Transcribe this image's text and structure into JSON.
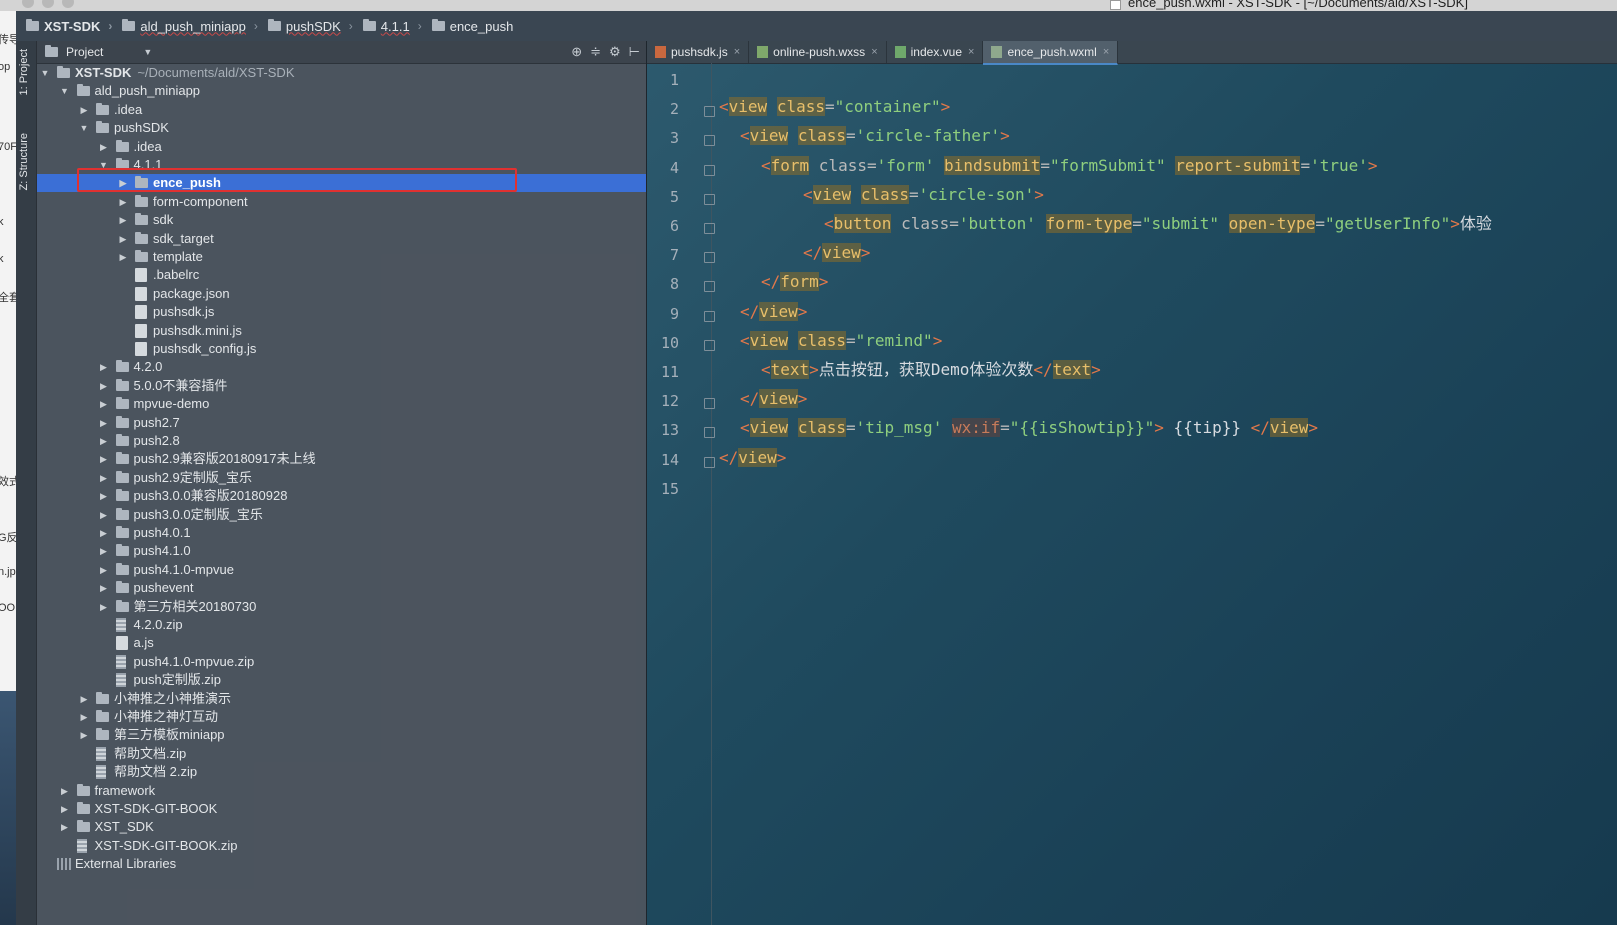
{
  "window": {
    "title": "ence_push.wxml - XST-SDK - [~/Documents/ald/XST-SDK]"
  },
  "breadcrumb": [
    {
      "label": "XST-SDK",
      "bold": true
    },
    {
      "label": "ald_push_miniapp"
    },
    {
      "label": "pushSDK"
    },
    {
      "label": "4.1.1"
    },
    {
      "label": "ence_push"
    }
  ],
  "left_strip_fragments": [
    "传导",
    "op",
    "70F",
    "k",
    "k",
    "全套",
    "效式",
    "G反",
    "n.jp",
    "OO"
  ],
  "tool_stripe": {
    "project_tab": "1: Project",
    "structure_tab": "Z: Structure"
  },
  "project_panel": {
    "title": "Project",
    "items": [
      {
        "label": "XST-SDK",
        "suffix": "~/Documents/ald/XST-SDK",
        "type": "folder",
        "state": "open"
      },
      {
        "label": "ald_push_miniapp",
        "type": "folder",
        "state": "open"
      },
      {
        "label": ".idea",
        "type": "folder",
        "state": "closed"
      },
      {
        "label": "pushSDK",
        "type": "folder",
        "state": "open"
      },
      {
        "label": ".idea",
        "type": "folder",
        "state": "closed"
      },
      {
        "label": "4.1.1",
        "type": "folder",
        "state": "open"
      },
      {
        "label": "ence_push",
        "type": "folder",
        "state": "closed",
        "selected": true
      },
      {
        "label": "form-component",
        "type": "folder",
        "state": "closed"
      },
      {
        "label": "sdk",
        "type": "folder",
        "state": "closed"
      },
      {
        "label": "sdk_target",
        "type": "folder",
        "state": "closed"
      },
      {
        "label": "template",
        "type": "folder",
        "state": "closed"
      },
      {
        "label": ".babelrc",
        "type": "file"
      },
      {
        "label": "package.json",
        "type": "file"
      },
      {
        "label": "pushsdk.js",
        "type": "file"
      },
      {
        "label": "pushsdk.mini.js",
        "type": "file"
      },
      {
        "label": "pushsdk_config.js",
        "type": "file"
      },
      {
        "label": "4.2.0",
        "type": "folder",
        "state": "closed"
      },
      {
        "label": "5.0.0不兼容插件",
        "type": "folder",
        "state": "closed"
      },
      {
        "label": "mpvue-demo",
        "type": "folder",
        "state": "closed"
      },
      {
        "label": "push2.7",
        "type": "folder",
        "state": "closed"
      },
      {
        "label": "push2.8",
        "type": "folder",
        "state": "closed"
      },
      {
        "label": "push2.9兼容版20180917未上线",
        "type": "folder",
        "state": "closed"
      },
      {
        "label": "push2.9定制版_宝乐",
        "type": "folder",
        "state": "closed"
      },
      {
        "label": "push3.0.0兼容版20180928",
        "type": "folder",
        "state": "closed"
      },
      {
        "label": "push3.0.0定制版_宝乐",
        "type": "folder",
        "state": "closed"
      },
      {
        "label": "push4.0.1",
        "type": "folder",
        "state": "closed"
      },
      {
        "label": "push4.1.0",
        "type": "folder",
        "state": "closed"
      },
      {
        "label": "push4.1.0-mpvue",
        "type": "folder",
        "state": "closed"
      },
      {
        "label": "pushevent",
        "type": "folder",
        "state": "closed"
      },
      {
        "label": "第三方相关20180730",
        "type": "folder",
        "state": "closed"
      },
      {
        "label": "4.2.0.zip",
        "type": "zip"
      },
      {
        "label": "a.js",
        "type": "file"
      },
      {
        "label": "push4.1.0-mpvue.zip",
        "type": "zip"
      },
      {
        "label": "push定制版.zip",
        "type": "zip"
      },
      {
        "label": "小神推之小神推演示",
        "type": "folder",
        "state": "closed"
      },
      {
        "label": "小神推之神灯互动",
        "type": "folder",
        "state": "closed"
      },
      {
        "label": "第三方模板miniapp",
        "type": "folder",
        "state": "closed"
      },
      {
        "label": "帮助文档.zip",
        "type": "zip"
      },
      {
        "label": "帮助文档 2.zip",
        "type": "zip"
      },
      {
        "label": "framework",
        "type": "folder",
        "state": "closed"
      },
      {
        "label": "XST-SDK-GIT-BOOK",
        "type": "folder",
        "state": "closed"
      },
      {
        "label": "XST_SDK",
        "type": "folder",
        "state": "closed"
      },
      {
        "label": "XST-SDK-GIT-BOOK.zip",
        "type": "zip"
      },
      {
        "label": "External Libraries",
        "type": "lib"
      }
    ]
  },
  "editor": {
    "tabs": [
      {
        "label": "pushsdk.js",
        "active": false
      },
      {
        "label": "online-push.wxss",
        "active": false
      },
      {
        "label": "index.vue",
        "active": false
      },
      {
        "label": "ence_push.wxml",
        "active": true
      }
    ],
    "line_numbers": [
      "1",
      "2",
      "3",
      "4",
      "5",
      "6",
      "7",
      "8",
      "9",
      "10",
      "11",
      "12",
      "13",
      "14",
      "15"
    ],
    "lines": [
      [],
      [
        [
          "tg",
          "<"
        ],
        [
          "tn",
          "view"
        ],
        [
          "tx",
          " "
        ],
        [
          "ah",
          "class"
        ],
        [
          "at",
          "="
        ],
        [
          "sv",
          "\"container\""
        ],
        [
          "tg",
          ">"
        ]
      ],
      [
        [
          "tg",
          "<"
        ],
        [
          "tn",
          "view"
        ],
        [
          "tx",
          " "
        ],
        [
          "ah",
          "class"
        ],
        [
          "at",
          "="
        ],
        [
          "sv",
          "'circle-father'"
        ],
        [
          "tg",
          ">"
        ]
      ],
      [
        [
          "tg",
          "<"
        ],
        [
          "tn",
          "form"
        ],
        [
          "at",
          " class="
        ],
        [
          "sv",
          "'form'"
        ],
        [
          "tx",
          " "
        ],
        [
          "ah",
          "bindsubmit"
        ],
        [
          "at",
          "="
        ],
        [
          "sv",
          "\"formSubmit\""
        ],
        [
          "tx",
          " "
        ],
        [
          "ah",
          "report-submit"
        ],
        [
          "at",
          "="
        ],
        [
          "sv",
          "'true'"
        ],
        [
          "tg",
          ">"
        ]
      ],
      [
        [
          "tg",
          "<"
        ],
        [
          "tn",
          "view"
        ],
        [
          "tx",
          " "
        ],
        [
          "ah",
          "class"
        ],
        [
          "at",
          "="
        ],
        [
          "sv",
          "'circle-son'"
        ],
        [
          "tg",
          ">"
        ]
      ],
      [
        [
          "tg",
          "<"
        ],
        [
          "tn",
          "button"
        ],
        [
          "at",
          " class="
        ],
        [
          "sv",
          "'button'"
        ],
        [
          "tx",
          " "
        ],
        [
          "ah",
          "form-type"
        ],
        [
          "at",
          "="
        ],
        [
          "sv",
          "\"submit\""
        ],
        [
          "tx",
          " "
        ],
        [
          "ah",
          "open-type"
        ],
        [
          "at",
          "="
        ],
        [
          "sv",
          "\"getUserInfo\""
        ],
        [
          "tg",
          ">"
        ],
        [
          "tx",
          "体验"
        ]
      ],
      [
        [
          "tg",
          "</"
        ],
        [
          "tn",
          "view"
        ],
        [
          "tg",
          ">"
        ]
      ],
      [
        [
          "tg",
          "</"
        ],
        [
          "tn",
          "form"
        ],
        [
          "tg",
          ">"
        ]
      ],
      [
        [
          "tg",
          "</"
        ],
        [
          "tn",
          "view"
        ],
        [
          "tg",
          ">"
        ]
      ],
      [
        [
          "tg",
          "<"
        ],
        [
          "tn",
          "view"
        ],
        [
          "tx",
          " "
        ],
        [
          "ah",
          "class"
        ],
        [
          "at",
          "="
        ],
        [
          "sv",
          "\"remind\""
        ],
        [
          "tg",
          ">"
        ]
      ],
      [
        [
          "tg",
          "<"
        ],
        [
          "tn",
          "text"
        ],
        [
          "tg",
          ">"
        ],
        [
          "tx",
          "点击按钮，获取Demo体验次数"
        ],
        [
          "tg",
          "</"
        ],
        [
          "tn",
          "text"
        ],
        [
          "tg",
          ">"
        ]
      ],
      [
        [
          "tg",
          "</"
        ],
        [
          "tn",
          "view"
        ],
        [
          "tg",
          ">"
        ]
      ],
      [
        [
          "tg",
          "<"
        ],
        [
          "tn",
          "view"
        ],
        [
          "tx",
          " "
        ],
        [
          "ah",
          "class"
        ],
        [
          "at",
          "="
        ],
        [
          "sv",
          "'tip_msg'"
        ],
        [
          "tx",
          " "
        ],
        [
          "mu",
          "wx:if"
        ],
        [
          "at",
          "="
        ],
        [
          "sv",
          "\"{{isShowtip}}\""
        ],
        [
          "tg",
          ">"
        ],
        [
          "tx",
          " {{tip}} "
        ],
        [
          "tg",
          "</"
        ],
        [
          "tn",
          "view"
        ],
        [
          "tg",
          ">"
        ]
      ],
      [
        [
          "tg",
          "</"
        ],
        [
          "tn",
          "view"
        ],
        [
          "tg",
          ">"
        ]
      ],
      []
    ],
    "indents": [
      0,
      0,
      1,
      2,
      4,
      5,
      4,
      2,
      1,
      1,
      2,
      1,
      1,
      0,
      0
    ]
  }
}
